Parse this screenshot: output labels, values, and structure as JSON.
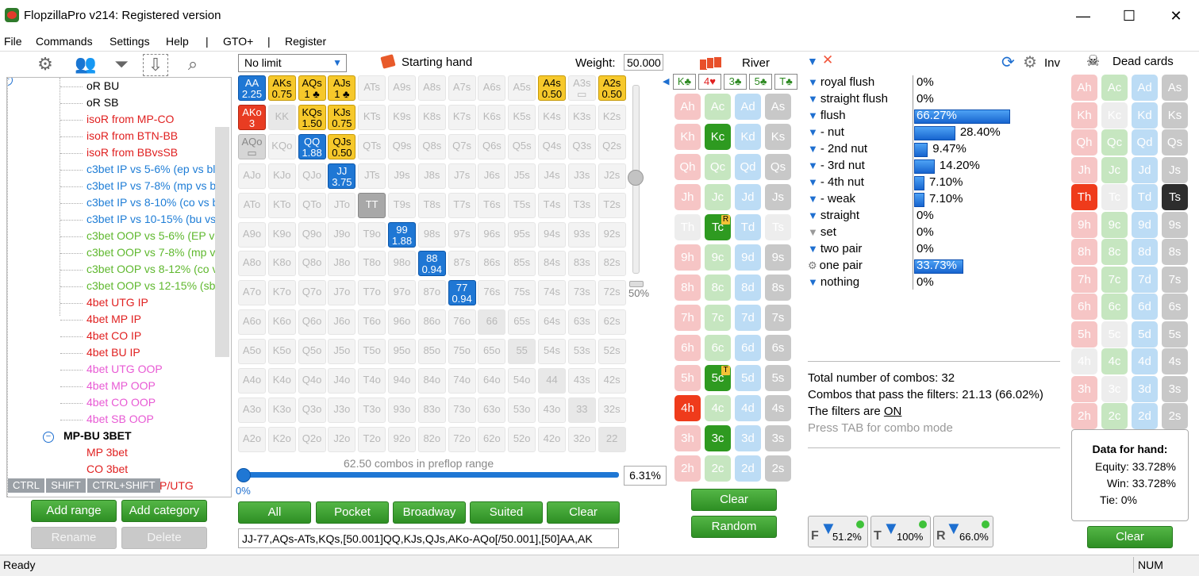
{
  "window": {
    "title": "FlopzillaPro v214: Registered version",
    "minimize": "—",
    "maximize": "☐",
    "close": "✕"
  },
  "menu": [
    "File",
    "Commands",
    "Settings",
    "Help",
    "|",
    "GTO+",
    "|",
    "Register"
  ],
  "tree": {
    "items": [
      {
        "label": "oR BU",
        "color": "#000000"
      },
      {
        "label": "oR SB",
        "color": "#000000"
      },
      {
        "label": "isoR from MP-CO",
        "color": "#e02020"
      },
      {
        "label": "isoR from BTN-BB",
        "color": "#e02020"
      },
      {
        "label": "isoR from BBvsSB",
        "color": "#e02020"
      },
      {
        "label": "c3bet IP vs 5-6% (ep vs bli",
        "color": "#1e7dd6"
      },
      {
        "label": "c3bet IP vs 7-8% (mp vs bl",
        "color": "#1e7dd6"
      },
      {
        "label": "c3bet IP vs 8-10% (co vs bl",
        "color": "#1e7dd6"
      },
      {
        "label": "c3bet IP vs 10-15% (bu vs",
        "color": "#1e7dd6"
      },
      {
        "label": "c3bet OOP vs 5-6% (EP vs",
        "color": "#5fb82e"
      },
      {
        "label": "c3bet OOP vs 7-8% (mp vs",
        "color": "#5fb82e"
      },
      {
        "label": "c3bet OOP vs 8-12% (co vs",
        "color": "#5fb82e"
      },
      {
        "label": "c3bet OOP vs 12-15% (sb",
        "color": "#5fb82e"
      },
      {
        "label": "4bet UTG IP",
        "color": "#e02020"
      },
      {
        "label": "4bet MP IP",
        "color": "#e02020"
      },
      {
        "label": "4bet CO IP",
        "color": "#e02020"
      },
      {
        "label": "4bet BU IP",
        "color": "#e02020"
      },
      {
        "label": "4bet UTG OOP",
        "color": "#e85ad4"
      },
      {
        "label": "4bet MP OOP",
        "color": "#e85ad4"
      },
      {
        "label": "4bet CO OOP",
        "color": "#e85ad4"
      },
      {
        "label": "4bet SB OOP",
        "color": "#e85ad4"
      }
    ],
    "group": "MP-BU 3BET",
    "group_items": [
      {
        "label": "MP 3bet",
        "color": "#e02020"
      },
      {
        "label": "CO 3bet",
        "color": "#e02020"
      },
      {
        "label": "P/UTG",
        "color": "#e02020"
      }
    ],
    "keys": [
      "CTRL",
      "SHIFT",
      "CTRL+SHIFT"
    ],
    "add_range": "Add range",
    "add_category": "Add category",
    "rename": "Rename",
    "delete": "Delete"
  },
  "range": {
    "limit": "No limit",
    "starting_hand": "Starting hand",
    "weight_label": "Weight:",
    "weight_value": "50.000",
    "slider_pct": "50%",
    "combos_text": "62.50 combos in preflop range",
    "range_pct_left": "0%",
    "range_pct": "6.31%",
    "buttons": [
      "All",
      "Pocket",
      "Broadway",
      "Suited",
      "Clear"
    ],
    "range_text": "JJ-77,AQs-ATs,KQs,[50.001]QQ,KJs,QJs,AKo-AQo[/50.001],[50]AA,AK",
    "grid": [
      [
        "AA|2.25|blu",
        "AKs|0.75|yel",
        "AQs|1 ♣|yel",
        "AJs|1 ♣|yel",
        "ATs||",
        "A9s||",
        "A8s||",
        "A7s||",
        "A6s||",
        "A5s||",
        "A4s|0.50|yel",
        "A3s|▭|",
        "A2s|0.50|yel"
      ],
      [
        "AKo|3|red",
        "KK||pair",
        "KQs|1.50|yel",
        "KJs|0.75|yel",
        "KTs||",
        "K9s||",
        "K8s||",
        "K7s||",
        "K6s||",
        "K5s||",
        "K4s||",
        "K3s||",
        "K2s||"
      ],
      [
        "AQo|▭|grylt",
        "KQo||",
        "QQ|1.88|blu",
        "QJs|0.50|yel",
        "QTs||",
        "Q9s||",
        "Q8s||",
        "Q7s||",
        "Q6s||",
        "Q5s||",
        "Q4s||",
        "Q3s||",
        "Q2s||"
      ],
      [
        "AJo||",
        "KJo||",
        "QJo||",
        "JJ|3.75|blu",
        "JTs||",
        "J9s||",
        "J8s||",
        "J7s||",
        "J6s||",
        "J5s||",
        "J4s||",
        "J3s||",
        "J2s||"
      ],
      [
        "ATo||",
        "KTo||",
        "QTo||",
        "JTo||",
        "TT||gry",
        "T9s||",
        "T8s||",
        "T7s||",
        "T6s||",
        "T5s||",
        "T4s||",
        "T3s||",
        "T2s||"
      ],
      [
        "A9o||",
        "K9o||",
        "Q9o||",
        "J9o||",
        "T9o||",
        "99|1.88|blu",
        "98s||",
        "97s||",
        "96s||",
        "95s||",
        "94s||",
        "93s||",
        "92s||"
      ],
      [
        "A8o||",
        "K8o||",
        "Q8o||",
        "J8o||",
        "T8o||",
        "98o||",
        "88|0.94|blu",
        "87s||",
        "86s||",
        "85s||",
        "84s||",
        "83s||",
        "82s||"
      ],
      [
        "A7o||",
        "K7o||",
        "Q7o||",
        "J7o||",
        "T7o||",
        "97o||",
        "87o||",
        "77|0.94|blu",
        "76s||",
        "75s||",
        "74s||",
        "73s||",
        "72s||"
      ],
      [
        "A6o||",
        "K6o||",
        "Q6o||",
        "J6o||",
        "T6o||",
        "96o||",
        "86o||",
        "76o||",
        "66||pair",
        "65s||",
        "64s||",
        "63s||",
        "62s||"
      ],
      [
        "A5o||",
        "K5o||",
        "Q5o||",
        "J5o||",
        "T5o||",
        "95o||",
        "85o||",
        "75o||",
        "65o||",
        "55||pair",
        "54s||",
        "53s||",
        "52s||"
      ],
      [
        "A4o||",
        "K4o||",
        "Q4o||",
        "J4o||",
        "T4o||",
        "94o||",
        "84o||",
        "74o||",
        "64o||",
        "54o||",
        "44||pair",
        "43s||",
        "42s||"
      ],
      [
        "A3o||",
        "K3o||",
        "Q3o||",
        "J3o||",
        "T3o||",
        "93o||",
        "83o||",
        "73o||",
        "63o||",
        "53o||",
        "43o||",
        "33||pair",
        "32s||"
      ],
      [
        "A2o||",
        "K2o||",
        "Q2o||",
        "J2o||",
        "T2o||",
        "92o||",
        "82o||",
        "72o||",
        "62o||",
        "52o||",
        "42o||",
        "32o||",
        "22||pair"
      ]
    ]
  },
  "board": {
    "label": "River",
    "cards": [
      "K♣",
      "4♥",
      "3♣",
      "5♣",
      "T♣"
    ],
    "clear": "Clear",
    "random": "Random",
    "ranks": [
      "A",
      "K",
      "Q",
      "J",
      "T",
      "9",
      "8",
      "7",
      "6",
      "5",
      "4",
      "3",
      "2"
    ],
    "selected": [
      "Kc",
      "Tc",
      "5c",
      "4h",
      "3c"
    ],
    "faded": [
      "Th",
      "Ts"
    ],
    "tags": {
      "Tc": "R",
      "5c": "T"
    }
  },
  "filters": {
    "inv": "Inv",
    "rows": [
      {
        "label": "royal flush",
        "pct": "0%",
        "bar": 0
      },
      {
        "label": "straight flush",
        "pct": "0%",
        "bar": 0
      },
      {
        "label": "flush",
        "pct": "66.27%",
        "bar": 66.27
      },
      {
        "label": "- nut",
        "pct": "28.40%",
        "bar": 28.4
      },
      {
        "label": "- 2nd nut",
        "pct": "9.47%",
        "bar": 9.47
      },
      {
        "label": "- 3rd nut",
        "pct": "14.20%",
        "bar": 14.2
      },
      {
        "label": "- 4th nut",
        "pct": "7.10%",
        "bar": 7.1
      },
      {
        "label": "- weak",
        "pct": "7.10%",
        "bar": 7.1
      },
      {
        "label": "straight",
        "pct": "0%",
        "bar": 0
      },
      {
        "label": "set",
        "pct": "0%",
        "bar": 0
      },
      {
        "label": "two pair",
        "pct": "0%",
        "bar": 0
      },
      {
        "label": "one pair",
        "pct": "33.73%",
        "bar": 33.73
      },
      {
        "label": "nothing",
        "pct": "0%",
        "bar": 0
      }
    ],
    "total": "Total number of combos: 32",
    "pass": "Combos that pass the filters: 21.13 (66.02%)",
    "filters_on_prefix": "The filters are ",
    "filters_on": "ON",
    "tab_hint": "Press TAB for combo mode",
    "street_boxes": [
      {
        "letter": "F",
        "value": "51.2%"
      },
      {
        "letter": "T",
        "value": "100%"
      },
      {
        "letter": "R",
        "value": "66.0%"
      }
    ]
  },
  "dead": {
    "label": "Dead cards",
    "selected": [
      "Th",
      "Ts"
    ],
    "faded": [
      "Kc",
      "Tc",
      "5c",
      "4h",
      "3c"
    ],
    "data_title": "Data for hand:",
    "equity": "Equity: 33.728%",
    "win": "Win: 33.728%",
    "tie": "Tie: 0%",
    "clear": "Clear"
  },
  "status": {
    "left": "Ready",
    "num": "NUM"
  }
}
